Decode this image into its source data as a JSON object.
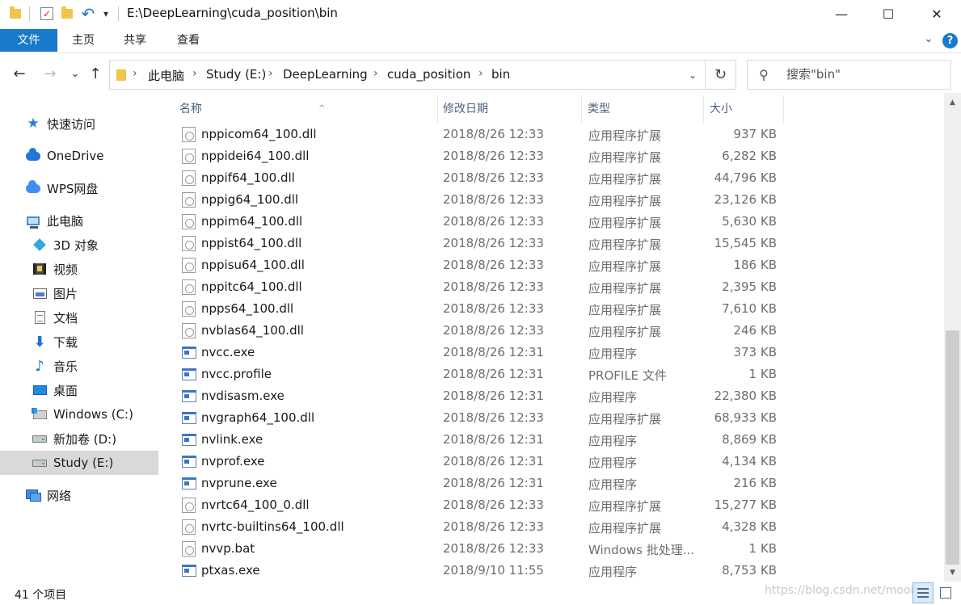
{
  "window": {
    "title": "E:\\DeepLearning\\cuda_position\\bin",
    "minimize_glyph": "—",
    "maximize_glyph": "☐",
    "close_glyph": "✕"
  },
  "quick_access_toolbar": {
    "undo_glyph": "↶",
    "dropdown_glyph": "▾",
    "check_glyph": "✓"
  },
  "ribbon": {
    "tabs": [
      "文件",
      "主页",
      "共享",
      "查看"
    ],
    "expand_glyph": "⌄",
    "help_glyph": "?"
  },
  "navigation": {
    "back_glyph": "←",
    "forward_glyph": "→",
    "recent_glyph": "⌄",
    "up_glyph": "↑",
    "breadcrumb": [
      "此电脑",
      "Study (E:)",
      "DeepLearning",
      "cuda_position",
      "bin"
    ],
    "separator": "›",
    "dropdown_glyph": "⌄",
    "refresh_glyph": "↻",
    "search_placeholder": "搜索\"bin\"",
    "search_glyph": "⚲"
  },
  "sidebar": {
    "items": [
      {
        "label": "快速访问",
        "icon": "star-icon"
      },
      {
        "label": "OneDrive",
        "icon": "onedrive-cloud-icon"
      },
      {
        "label": "WPS网盘",
        "icon": "wps-cloud-icon"
      },
      {
        "label": "此电脑",
        "icon": "computer-icon"
      },
      {
        "label": "3D 对象",
        "icon": "cube-3d-icon"
      },
      {
        "label": "视频",
        "icon": "video-icon"
      },
      {
        "label": "图片",
        "icon": "picture-icon"
      },
      {
        "label": "文档",
        "icon": "document-icon"
      },
      {
        "label": "下载",
        "icon": "download-arrow-icon"
      },
      {
        "label": "音乐",
        "icon": "music-note-icon"
      },
      {
        "label": "桌面",
        "icon": "desktop-icon"
      },
      {
        "label": "Windows (C:)",
        "icon": "system-drive-icon"
      },
      {
        "label": "新加卷 (D:)",
        "icon": "drive-icon"
      },
      {
        "label": "Study (E:)",
        "icon": "drive-icon",
        "selected": true
      },
      {
        "label": "网络",
        "icon": "network-icon"
      }
    ],
    "star_glyph": "★",
    "download_glyph": "⬇",
    "music_glyph": "♪"
  },
  "file_list": {
    "columns": [
      "名称",
      "修改日期",
      "类型",
      "大小"
    ],
    "sort_glyph": "^",
    "rows": [
      {
        "name": "nppicom64_100.dll",
        "date": "2018/8/26 12:33",
        "type": "应用程序扩展",
        "size": "937 KB",
        "icon": "dll"
      },
      {
        "name": "nppidei64_100.dll",
        "date": "2018/8/26 12:33",
        "type": "应用程序扩展",
        "size": "6,282 KB",
        "icon": "dll"
      },
      {
        "name": "nppif64_100.dll",
        "date": "2018/8/26 12:33",
        "type": "应用程序扩展",
        "size": "44,796 KB",
        "icon": "dll"
      },
      {
        "name": "nppig64_100.dll",
        "date": "2018/8/26 12:33",
        "type": "应用程序扩展",
        "size": "23,126 KB",
        "icon": "dll"
      },
      {
        "name": "nppim64_100.dll",
        "date": "2018/8/26 12:33",
        "type": "应用程序扩展",
        "size": "5,630 KB",
        "icon": "dll"
      },
      {
        "name": "nppist64_100.dll",
        "date": "2018/8/26 12:33",
        "type": "应用程序扩展",
        "size": "15,545 KB",
        "icon": "dll"
      },
      {
        "name": "nppisu64_100.dll",
        "date": "2018/8/26 12:33",
        "type": "应用程序扩展",
        "size": "186 KB",
        "icon": "dll"
      },
      {
        "name": "nppitc64_100.dll",
        "date": "2018/8/26 12:33",
        "type": "应用程序扩展",
        "size": "2,395 KB",
        "icon": "dll"
      },
      {
        "name": "npps64_100.dll",
        "date": "2018/8/26 12:33",
        "type": "应用程序扩展",
        "size": "7,610 KB",
        "icon": "dll"
      },
      {
        "name": "nvblas64_100.dll",
        "date": "2018/8/26 12:33",
        "type": "应用程序扩展",
        "size": "246 KB",
        "icon": "dll"
      },
      {
        "name": "nvcc.exe",
        "date": "2018/8/26 12:31",
        "type": "应用程序",
        "size": "373 KB",
        "icon": "exe"
      },
      {
        "name": "nvcc.profile",
        "date": "2018/8/26 12:31",
        "type": "PROFILE 文件",
        "size": "1 KB",
        "icon": "exe"
      },
      {
        "name": "nvdisasm.exe",
        "date": "2018/8/26 12:31",
        "type": "应用程序",
        "size": "22,380 KB",
        "icon": "exe"
      },
      {
        "name": "nvgraph64_100.dll",
        "date": "2018/8/26 12:33",
        "type": "应用程序扩展",
        "size": "68,933 KB",
        "icon": "exe"
      },
      {
        "name": "nvlink.exe",
        "date": "2018/8/26 12:31",
        "type": "应用程序",
        "size": "8,869 KB",
        "icon": "exe"
      },
      {
        "name": "nvprof.exe",
        "date": "2018/8/26 12:31",
        "type": "应用程序",
        "size": "4,134 KB",
        "icon": "exe"
      },
      {
        "name": "nvprune.exe",
        "date": "2018/8/26 12:31",
        "type": "应用程序",
        "size": "216 KB",
        "icon": "exe"
      },
      {
        "name": "nvrtc64_100_0.dll",
        "date": "2018/8/26 12:33",
        "type": "应用程序扩展",
        "size": "15,277 KB",
        "icon": "dll"
      },
      {
        "name": "nvrtc-builtins64_100.dll",
        "date": "2018/8/26 12:33",
        "type": "应用程序扩展",
        "size": "4,328 KB",
        "icon": "dll"
      },
      {
        "name": "nvvp.bat",
        "date": "2018/8/26 12:33",
        "type": "Windows 批处理...",
        "size": "1 KB",
        "icon": "dll"
      },
      {
        "name": "ptxas.exe",
        "date": "2018/9/10 11:55",
        "type": "应用程序",
        "size": "8,753 KB",
        "icon": "exe"
      }
    ]
  },
  "scrollbar": {
    "up_glyph": "▲",
    "down_glyph": "▼"
  },
  "status_bar": {
    "item_count": "41 个项目",
    "watermark": "https://blog.csdn.net/moon"
  },
  "colors": {
    "accent": "#1979ca",
    "selected_bg": "#d9d9d9",
    "header_text": "#4c607a"
  }
}
